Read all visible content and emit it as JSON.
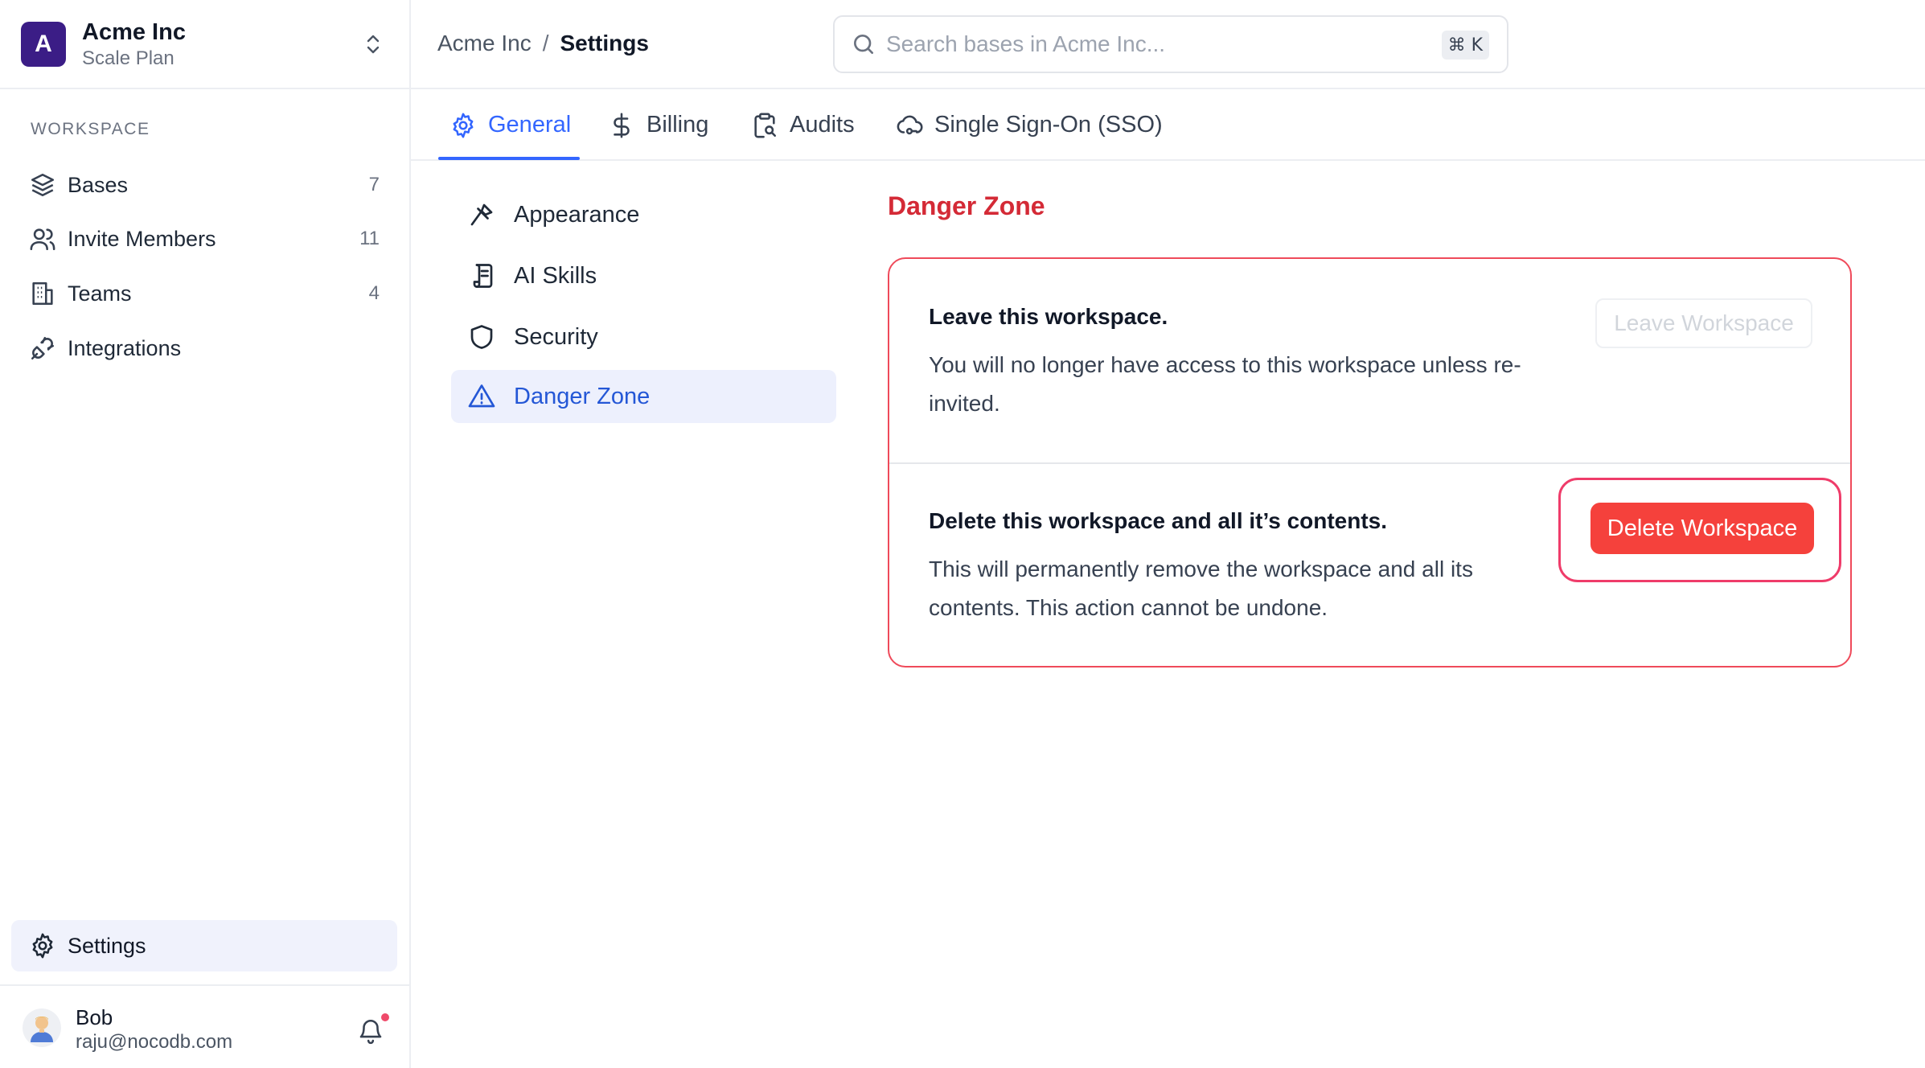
{
  "workspace": {
    "avatar_letter": "A",
    "name": "Acme Inc",
    "plan": "Scale Plan",
    "brand_color": "#3b1d86"
  },
  "sidebar": {
    "section_label": "WORKSPACE",
    "items": [
      {
        "label": "Bases",
        "count": "7",
        "icon": "layers-icon"
      },
      {
        "label": "Invite Members",
        "count": "11",
        "icon": "users-icon"
      },
      {
        "label": "Teams",
        "count": "4",
        "icon": "building-icon"
      },
      {
        "label": "Integrations",
        "count": "",
        "icon": "plug-icon"
      }
    ],
    "settings_label": "Settings"
  },
  "user": {
    "name": "Bob",
    "email": "raju@nocodb.com"
  },
  "breadcrumb": {
    "parent": "Acme Inc",
    "separator": "/",
    "current": "Settings"
  },
  "search": {
    "placeholder": "Search bases in Acme Inc...",
    "shortcut": "⌘ K"
  },
  "tabs": [
    {
      "label": "General",
      "active": true
    },
    {
      "label": "Billing",
      "active": false
    },
    {
      "label": "Audits",
      "active": false
    },
    {
      "label": "Single Sign-On (SSO)",
      "active": false
    }
  ],
  "subnav": [
    {
      "label": "Appearance"
    },
    {
      "label": "AI Skills"
    },
    {
      "label": "Security"
    },
    {
      "label": "Danger Zone",
      "active": true
    }
  ],
  "danger_zone": {
    "title": "Danger Zone",
    "leave": {
      "heading": "Leave this workspace.",
      "description": "You will no longer have access to this workspace unless re-invited.",
      "button": "Leave Workspace"
    },
    "delete": {
      "heading": "Delete this workspace and all it’s contents.",
      "description": "This will permanently remove the workspace and all its contents. This action cannot be undone.",
      "button": "Delete Workspace"
    }
  },
  "colors": {
    "accent": "#3366ff",
    "danger": "#f5413c",
    "danger_text": "#d42a36"
  }
}
